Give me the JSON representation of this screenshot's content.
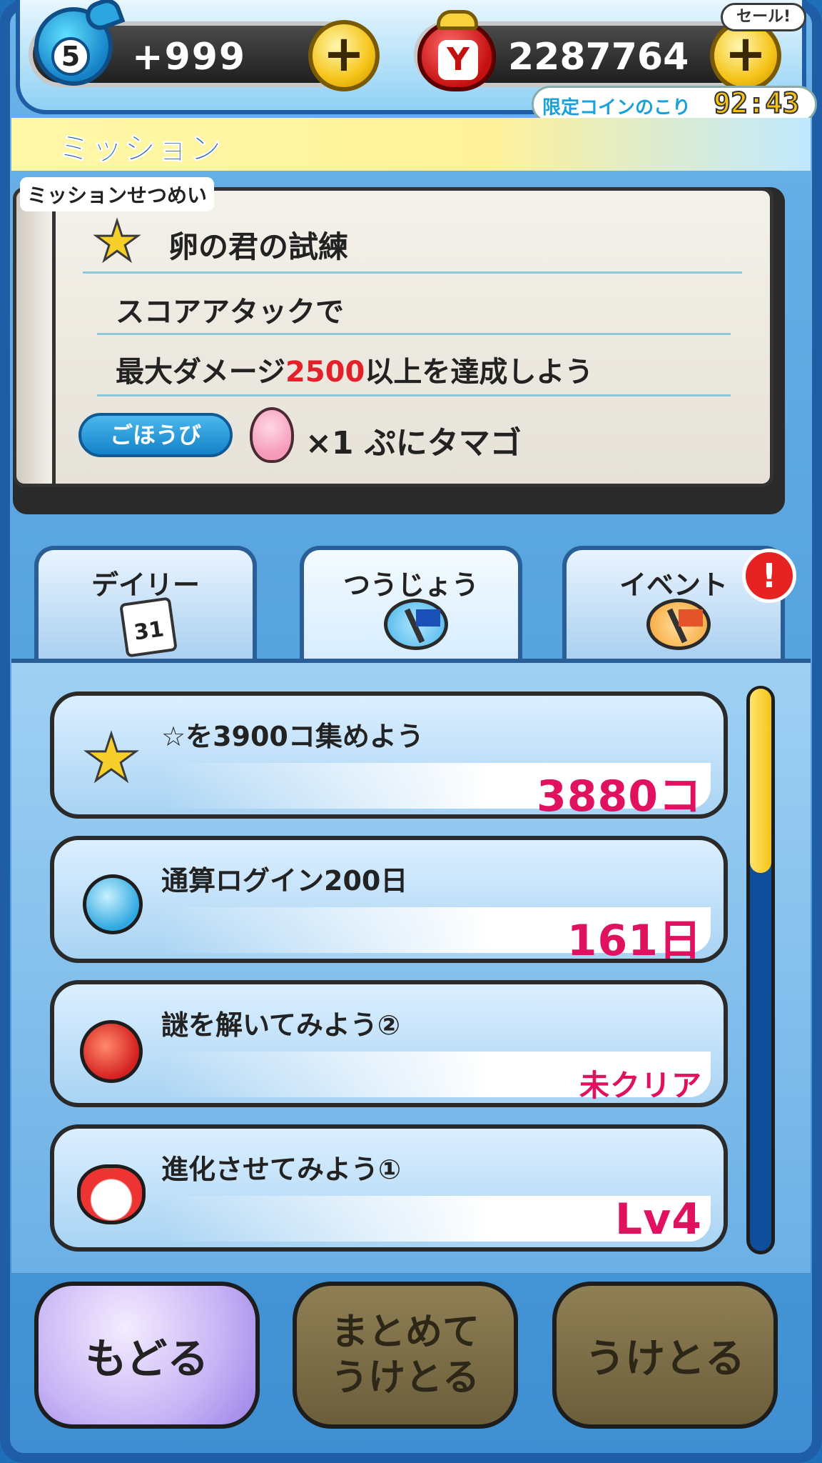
{
  "top_bar": {
    "watch_level": "5",
    "stamina": "+999",
    "coins": "2287764",
    "coin_icon": "Y",
    "sale_label": "セール!",
    "limited_coin_label": "限定コインのこり",
    "limited_coin_time": "92:43"
  },
  "header": {
    "title": "ミッション"
  },
  "mission_detail": {
    "label": "ミッションせつめい",
    "title": "卵の君の試練",
    "desc_line1": "スコアアタックで",
    "desc_line2_prefix": "最大ダメージ",
    "desc_line2_value": "2500",
    "desc_line2_suffix": "以上を達成しよう",
    "reward_badge": "ごほうび",
    "reward_text": "×1 ぷにタマゴ"
  },
  "tabs": [
    {
      "label": "デイリー",
      "icon": "calendar-icon",
      "icon_text": "31"
    },
    {
      "label": "つうじょう",
      "icon": "blue-flag-icon",
      "active": true
    },
    {
      "label": "イベント",
      "icon": "orange-flag-icon",
      "alert": "!"
    }
  ],
  "missions": [
    {
      "title": "☆を3900コ集めよう",
      "progress": "3880コ",
      "icon": "star-icon"
    },
    {
      "title": "通算ログイン200日",
      "progress": "161日",
      "icon": "watch-icon"
    },
    {
      "title": "謎を解いてみよう②",
      "progress": "未クリア",
      "icon": "puzzle-icon"
    },
    {
      "title": "進化させてみよう①",
      "progress": "Lv4",
      "icon": "cat-icon"
    }
  ],
  "scroll": {
    "position_fraction": 0.0,
    "visible_fraction": 0.32
  },
  "buttons": {
    "back": "もどる",
    "collect_all_line1": "まとめて",
    "collect_all_line2": "うけとる",
    "collect": "うけとる"
  },
  "colors": {
    "accent_blue": "#1f5ea6",
    "progress_pink": "#e0115f",
    "highlight_red": "#e3212b",
    "scroll_yellow": "#f5c418"
  }
}
